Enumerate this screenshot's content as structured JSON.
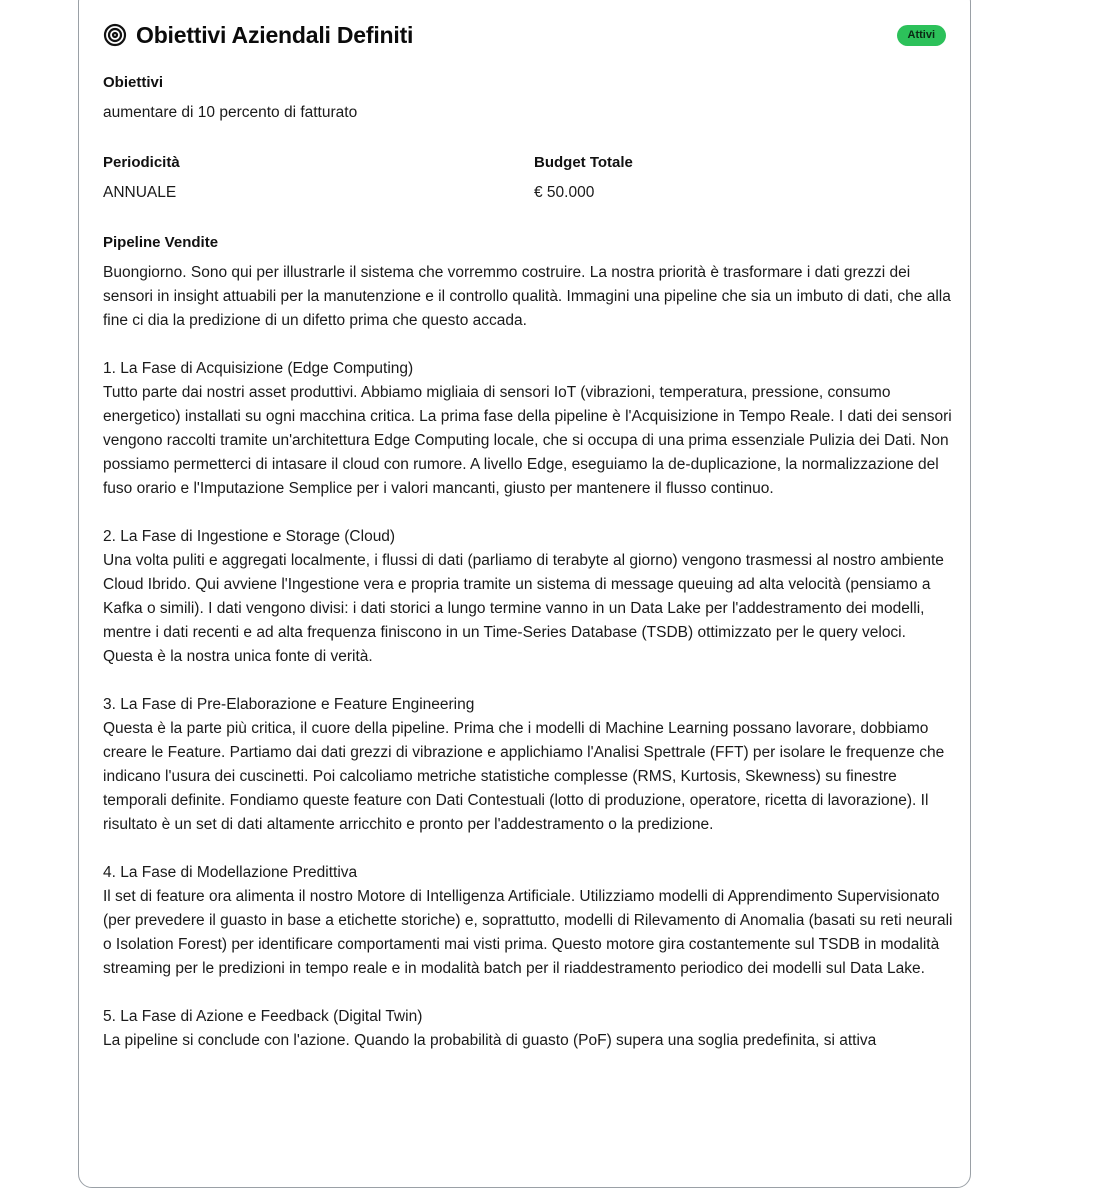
{
  "header": {
    "title": "Obiettivi Aziendali Definiti",
    "status_badge": "Attivi",
    "icon": "target-icon"
  },
  "objectives": {
    "label": "Obiettivi",
    "value": "aumentare di 10 percento di fatturato"
  },
  "periodicity": {
    "label": "Periodicità",
    "value": "ANNUALE"
  },
  "budget": {
    "label": "Budget Totale",
    "value": "€ 50.000"
  },
  "pipeline": {
    "label": "Pipeline Vendite",
    "text": "Buongiorno. Sono qui per illustrarle il sistema che vorremmo costruire. La nostra priorità è trasformare i dati grezzi dei sensori in insight attuabili per la manutenzione e il controllo qualità. Immagini una pipeline che sia un imbuto di dati, che alla fine ci dia la predizione di un difetto prima che questo accada.\n\n1. La Fase di Acquisizione (Edge Computing)\nTutto parte dai nostri asset produttivi. Abbiamo migliaia di sensori IoT (vibrazioni, temperatura, pressione, consumo energetico) installati su ogni macchina critica. La prima fase della pipeline è l'Acquisizione in Tempo Reale. I dati dei sensori vengono raccolti tramite un'architettura Edge Computing locale, che si occupa di una prima essenziale Pulizia dei Dati. Non possiamo permetterci di intasare il cloud con rumore. A livello Edge, eseguiamo la de-duplicazione, la normalizzazione del fuso orario e l'Imputazione Semplice per i valori mancanti, giusto per mantenere il flusso continuo.\n\n2. La Fase di Ingestione e Storage (Cloud)\nUna volta puliti e aggregati localmente, i flussi di dati (parliamo di terabyte al giorno) vengono trasmessi al nostro ambiente Cloud Ibrido. Qui avviene l'Ingestione vera e propria tramite un sistema di message queuing ad alta velocità (pensiamo a Kafka o simili). I dati vengono divisi: i dati storici a lungo termine vanno in un Data Lake per l'addestramento dei modelli, mentre i dati recenti e ad alta frequenza finiscono in un Time-Series Database (TSDB) ottimizzato per le query veloci. Questa è la nostra unica fonte di verità.\n\n3. La Fase di Pre-Elaborazione e Feature Engineering\nQuesta è la parte più critica, il cuore della pipeline. Prima che i modelli di Machine Learning possano lavorare, dobbiamo creare le Feature. Partiamo dai dati grezzi di vibrazione e applichiamo l'Analisi Spettrale (FFT) per isolare le frequenze che indicano l'usura dei cuscinetti. Poi calcoliamo metriche statistiche complesse (RMS, Kurtosis, Skewness) su finestre temporali definite. Fondiamo queste feature con Dati Contestuali (lotto di produzione, operatore, ricetta di lavorazione). Il risultato è un set di dati altamente arricchito e pronto per l'addestramento o la predizione.\n\n4. La Fase di Modellazione Predittiva\nIl set di feature ora alimenta il nostro Motore di Intelligenza Artificiale. Utilizziamo modelli di Apprendimento Supervisionato (per prevedere il guasto in base a etichette storiche) e, soprattutto, modelli di Rilevamento di Anomalia (basati su reti neurali o Isolation Forest) per identificare comportamenti mai visti prima. Questo motore gira costantemente sul TSDB in modalità streaming per le predizioni in tempo reale e in modalità batch per il riaddestramento periodico dei modelli sul Data Lake.\n\n5. La Fase di Azione e Feedback (Digital Twin)\nLa pipeline si conclude con l'azione. Quando la probabilità di guasto (PoF) supera una soglia predefinita, si attiva"
  },
  "colors": {
    "badge_bg": "#2cc15a",
    "card_border": "#9aa0a6"
  }
}
